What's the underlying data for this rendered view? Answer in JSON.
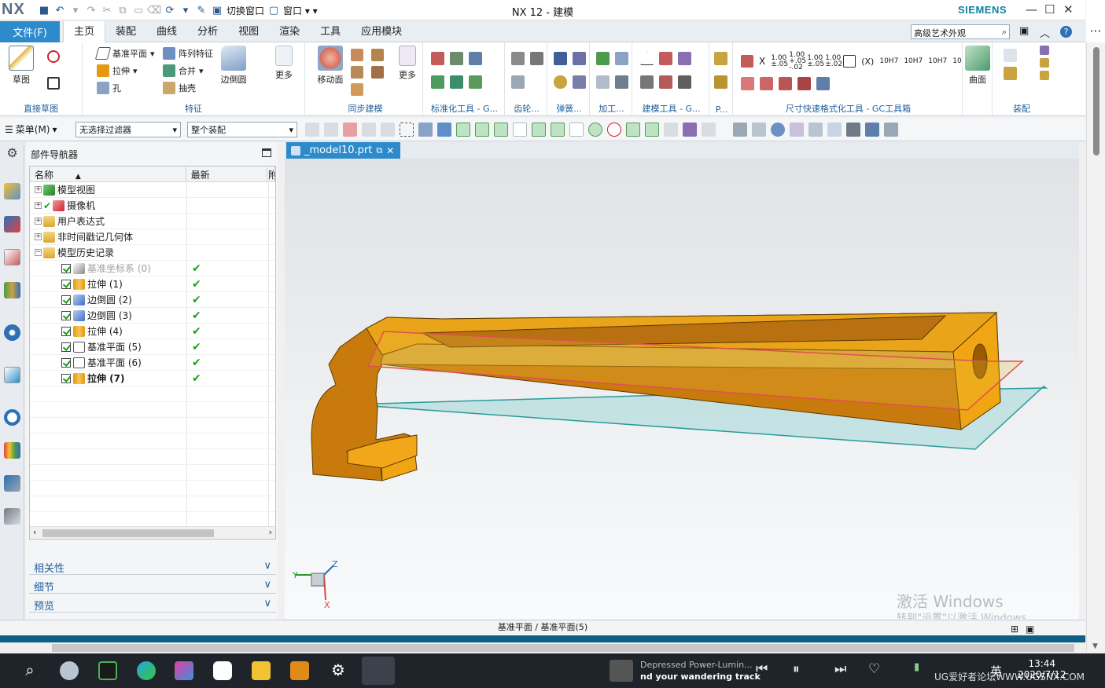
{
  "window": {
    "app_logo": "NX",
    "title": "NX 12 - 建模",
    "brand": "SIEMENS",
    "controls": [
      "minimize-icon",
      "maximize-icon",
      "close-icon"
    ]
  },
  "menu": {
    "file_label": "文件(F)",
    "tabs": [
      {
        "label": "主页",
        "active": true
      },
      {
        "label": "装配"
      },
      {
        "label": "曲线"
      },
      {
        "label": "分析"
      },
      {
        "label": "视图"
      },
      {
        "label": "渲染"
      },
      {
        "label": "工具"
      },
      {
        "label": "应用模块"
      }
    ],
    "search_value": "高级艺术外观"
  },
  "ribbon": {
    "direct_sketch": {
      "label": "直接草图",
      "sketch": "草图"
    },
    "feature": {
      "label": "特征",
      "datum_plane": "基准平面",
      "extrude": "拉伸",
      "hole": "孔",
      "pattern": "阵列特征",
      "unite": "合并",
      "shell": "抽壳",
      "edge_blend": "边倒圆",
      "more": "更多"
    },
    "sync": {
      "label": "同步建模",
      "move_face": "移动面",
      "more": "更多"
    },
    "std_tools": "标准化工具 - G...",
    "gear": "齿轮...",
    "spring": "弹簧...",
    "machining": "加工...",
    "modeling_tools": "建模工具 - G...",
    "p_more": "P...",
    "dimension_tools": "尺寸快速格式化工具 - GC工具箱",
    "surface": {
      "button": "曲面"
    },
    "assembly": "装配",
    "tol_labels": [
      "X",
      "1.00 ±.05",
      "1.00 +.05 -.02",
      "1.00 ±.05",
      "1.00 ±.02",
      "(X)",
      "10H7",
      "10H7",
      "10H7",
      "10"
    ]
  },
  "toolbar2": {
    "menu_label": "菜单(M)",
    "filter": "无选择过滤器",
    "scope": "整个装配"
  },
  "navigator": {
    "title": "部件导航器",
    "col_name": "名称",
    "col_latest": "最新",
    "col_extra": "附",
    "rows": [
      {
        "label": "模型视图",
        "level": 0,
        "icon": "model-view-icon"
      },
      {
        "label": "摄像机",
        "level": 0,
        "icon": "camera-icon"
      },
      {
        "label": "用户表达式",
        "level": 0,
        "icon": "folder-icon"
      },
      {
        "label": "非时间戳记几何体",
        "level": 0,
        "icon": "folder-icon"
      },
      {
        "label": "模型历史记录",
        "level": 0,
        "icon": "folder-icon"
      },
      {
        "label": "基准坐标系 (0)",
        "level": 1,
        "icon": "datum-csys-icon",
        "latest": "✔",
        "dim": true
      },
      {
        "label": "拉伸 (1)",
        "level": 1,
        "icon": "extrude-icon",
        "latest": "✔"
      },
      {
        "label": "边倒圆 (2)",
        "level": 1,
        "icon": "edge-blend-icon",
        "latest": "✔"
      },
      {
        "label": "边倒圆 (3)",
        "level": 1,
        "icon": "edge-blend-icon",
        "latest": "✔"
      },
      {
        "label": "拉伸 (4)",
        "level": 1,
        "icon": "extrude-icon",
        "latest": "✔"
      },
      {
        "label": "基准平面 (5)",
        "level": 1,
        "icon": "datum-plane-icon",
        "latest": "✔"
      },
      {
        "label": "基准平面 (6)",
        "level": 1,
        "icon": "datum-plane-icon",
        "latest": "✔"
      },
      {
        "label": "拉伸 (7)",
        "level": 1,
        "icon": "extrude-icon",
        "latest": "✔",
        "bold": true
      }
    ],
    "panels": [
      "相关性",
      "细节",
      "预览"
    ]
  },
  "graphics": {
    "tab_label": "_model10.prt",
    "triad": {
      "x": "X",
      "y": "Y",
      "z": "Z"
    },
    "watermark_title": "激活 Windows",
    "watermark_sub": "转到\"设置\"以激活 Windows。"
  },
  "status": "基准平面 / 基准平面(5)",
  "taskbar": {
    "media_artist": "Depressed Power-Lumin...",
    "media_title": "nd your wandering track",
    "ime": "英",
    "time": "13:44",
    "date": "2020/7/12",
    "forum": "UG爱好者论坛WWW.UGSNX.COM"
  },
  "colors": {
    "accent": "#2e8bcb",
    "part": "#e39a10",
    "datum_plane_edge": "#2a9a9a",
    "selected_plane": "#e05050",
    "check_green": "#1aa31a"
  }
}
